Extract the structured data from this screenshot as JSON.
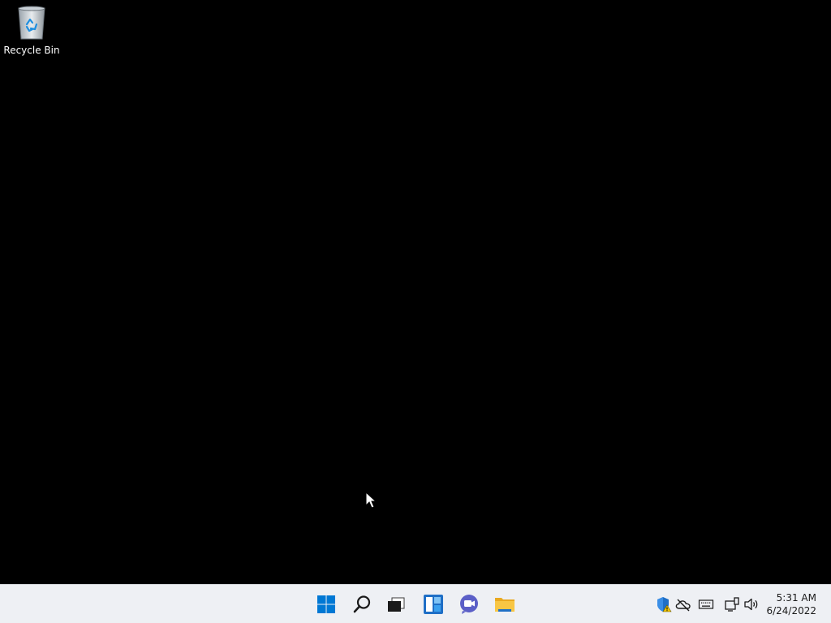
{
  "desktop": {
    "background_color": "#000000",
    "icons": [
      {
        "label": "Recycle Bin",
        "icon": "recycle-bin-icon"
      }
    ]
  },
  "taskbar": {
    "background_color": "#eef0f4",
    "pinned": [
      {
        "name": "start-button",
        "icon": "windows-logo-icon"
      },
      {
        "name": "search-button",
        "icon": "search-icon"
      },
      {
        "name": "task-view-button",
        "icon": "task-view-icon"
      },
      {
        "name": "widgets-button",
        "icon": "widgets-icon"
      },
      {
        "name": "chat-button",
        "icon": "teams-chat-icon"
      },
      {
        "name": "file-explorer-button",
        "icon": "folder-icon"
      }
    ],
    "tray": [
      {
        "icon": "security-warning-icon"
      },
      {
        "icon": "onedrive-offline-icon"
      },
      {
        "icon": "keyboard-icon"
      },
      {
        "icon": "network-icon"
      },
      {
        "icon": "volume-icon"
      }
    ],
    "clock": {
      "time": "5:31 AM",
      "date": "6/24/2022"
    }
  },
  "colors": {
    "windows_blue": "#0078d4",
    "teams_purple": "#5b5fc7",
    "folder_yellow": "#f8c644"
  }
}
